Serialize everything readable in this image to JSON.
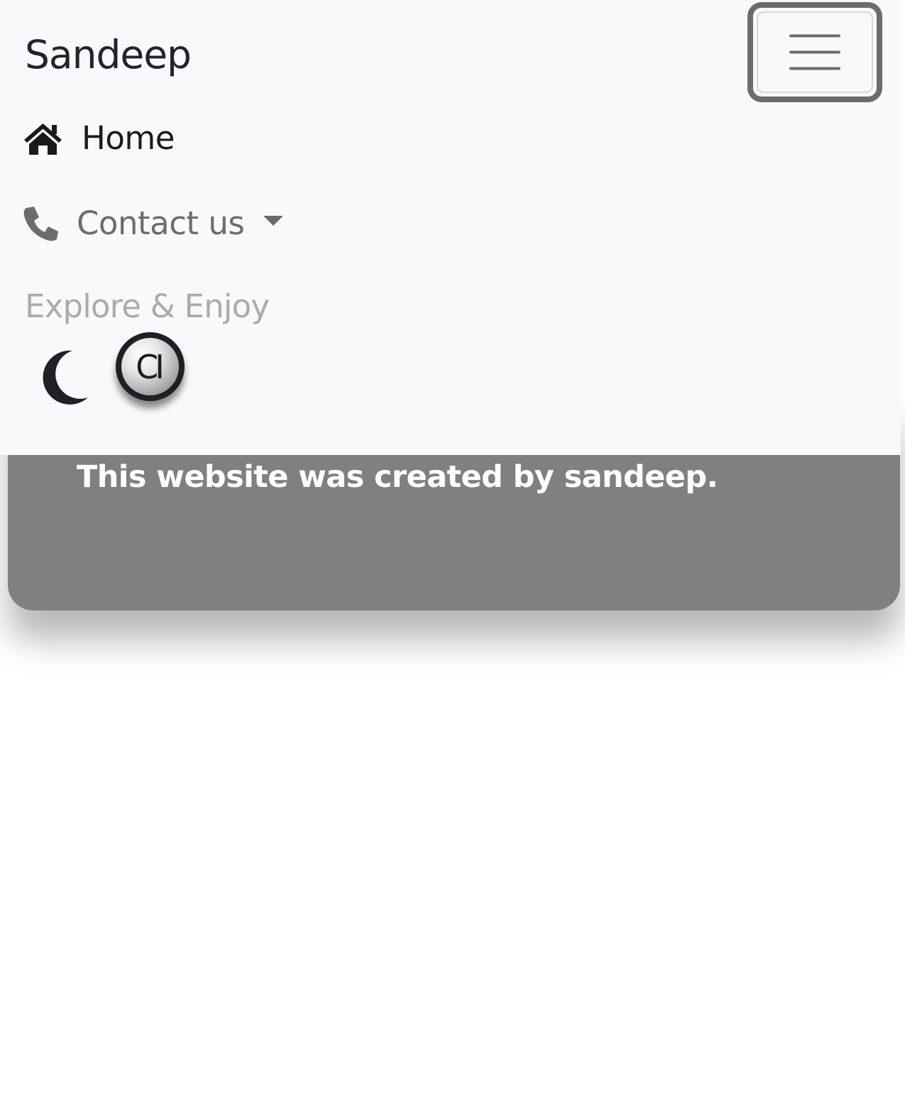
{
  "navbar": {
    "brand": "Sandeep",
    "toggler_icon": "hamburger-menu-icon",
    "items": [
      {
        "label": "Home",
        "icon": "home-icon",
        "active": true
      },
      {
        "label": "Contact us",
        "icon": "phone-icon",
        "dropdown": true
      }
    ],
    "tagline": "Explore & Enjoy",
    "theme_toggle_icon": "moon-icon",
    "badge_label": "CI"
  },
  "footer": {
    "text": "This website was created by sandeep."
  },
  "colors": {
    "navbar_bg": "#f8f9fa",
    "footer_bg": "#808080",
    "brand_text": "#212529",
    "muted_text": "#6c6c6c",
    "tagline_text": "#a9abad"
  }
}
